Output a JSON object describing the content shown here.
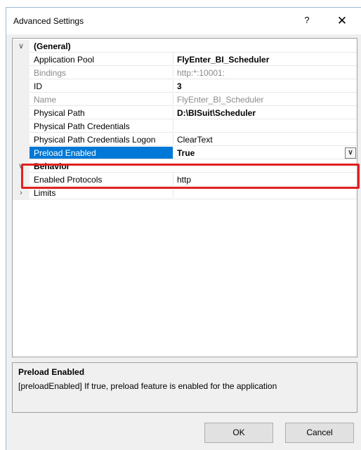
{
  "window": {
    "title": "Advanced Settings",
    "help_label": "?",
    "close_label": "✕"
  },
  "grid": {
    "rows": [
      {
        "type": "category",
        "expander": "∨",
        "name": "(General)"
      },
      {
        "type": "property",
        "name": "Application Pool",
        "value": "FlyEnter_BI_Scheduler",
        "value_bold": true
      },
      {
        "type": "property",
        "name": "Bindings",
        "value": "http:*:10001:",
        "readonly": true
      },
      {
        "type": "property",
        "name": "ID",
        "value": "3",
        "value_bold": true
      },
      {
        "type": "property",
        "name": "Name",
        "value": "FlyEnter_BI_Scheduler",
        "readonly": true
      },
      {
        "type": "property",
        "name": "Physical Path",
        "value": "D:\\BISuit\\Scheduler",
        "value_bold": true
      },
      {
        "type": "property",
        "name": "Physical Path Credentials",
        "value": ""
      },
      {
        "type": "property",
        "name": "Physical Path Credentials Logon",
        "value": "ClearText"
      },
      {
        "type": "property",
        "name": "Preload Enabled",
        "value": "True",
        "selected": true,
        "dropdown": "∨"
      },
      {
        "type": "category",
        "expander": "∨",
        "name": "Behavior"
      },
      {
        "type": "property",
        "name": "Enabled Protocols",
        "value": "http"
      },
      {
        "type": "category-collapsed",
        "expander": "›",
        "name": "Limits"
      }
    ]
  },
  "description": {
    "title": "Preload Enabled",
    "text": "[preloadEnabled] If true, preload feature is enabled for the application"
  },
  "buttons": {
    "ok": "OK",
    "cancel": "Cancel"
  },
  "colors": {
    "selection": "#0078d7",
    "highlight_box": "#e0201e"
  }
}
